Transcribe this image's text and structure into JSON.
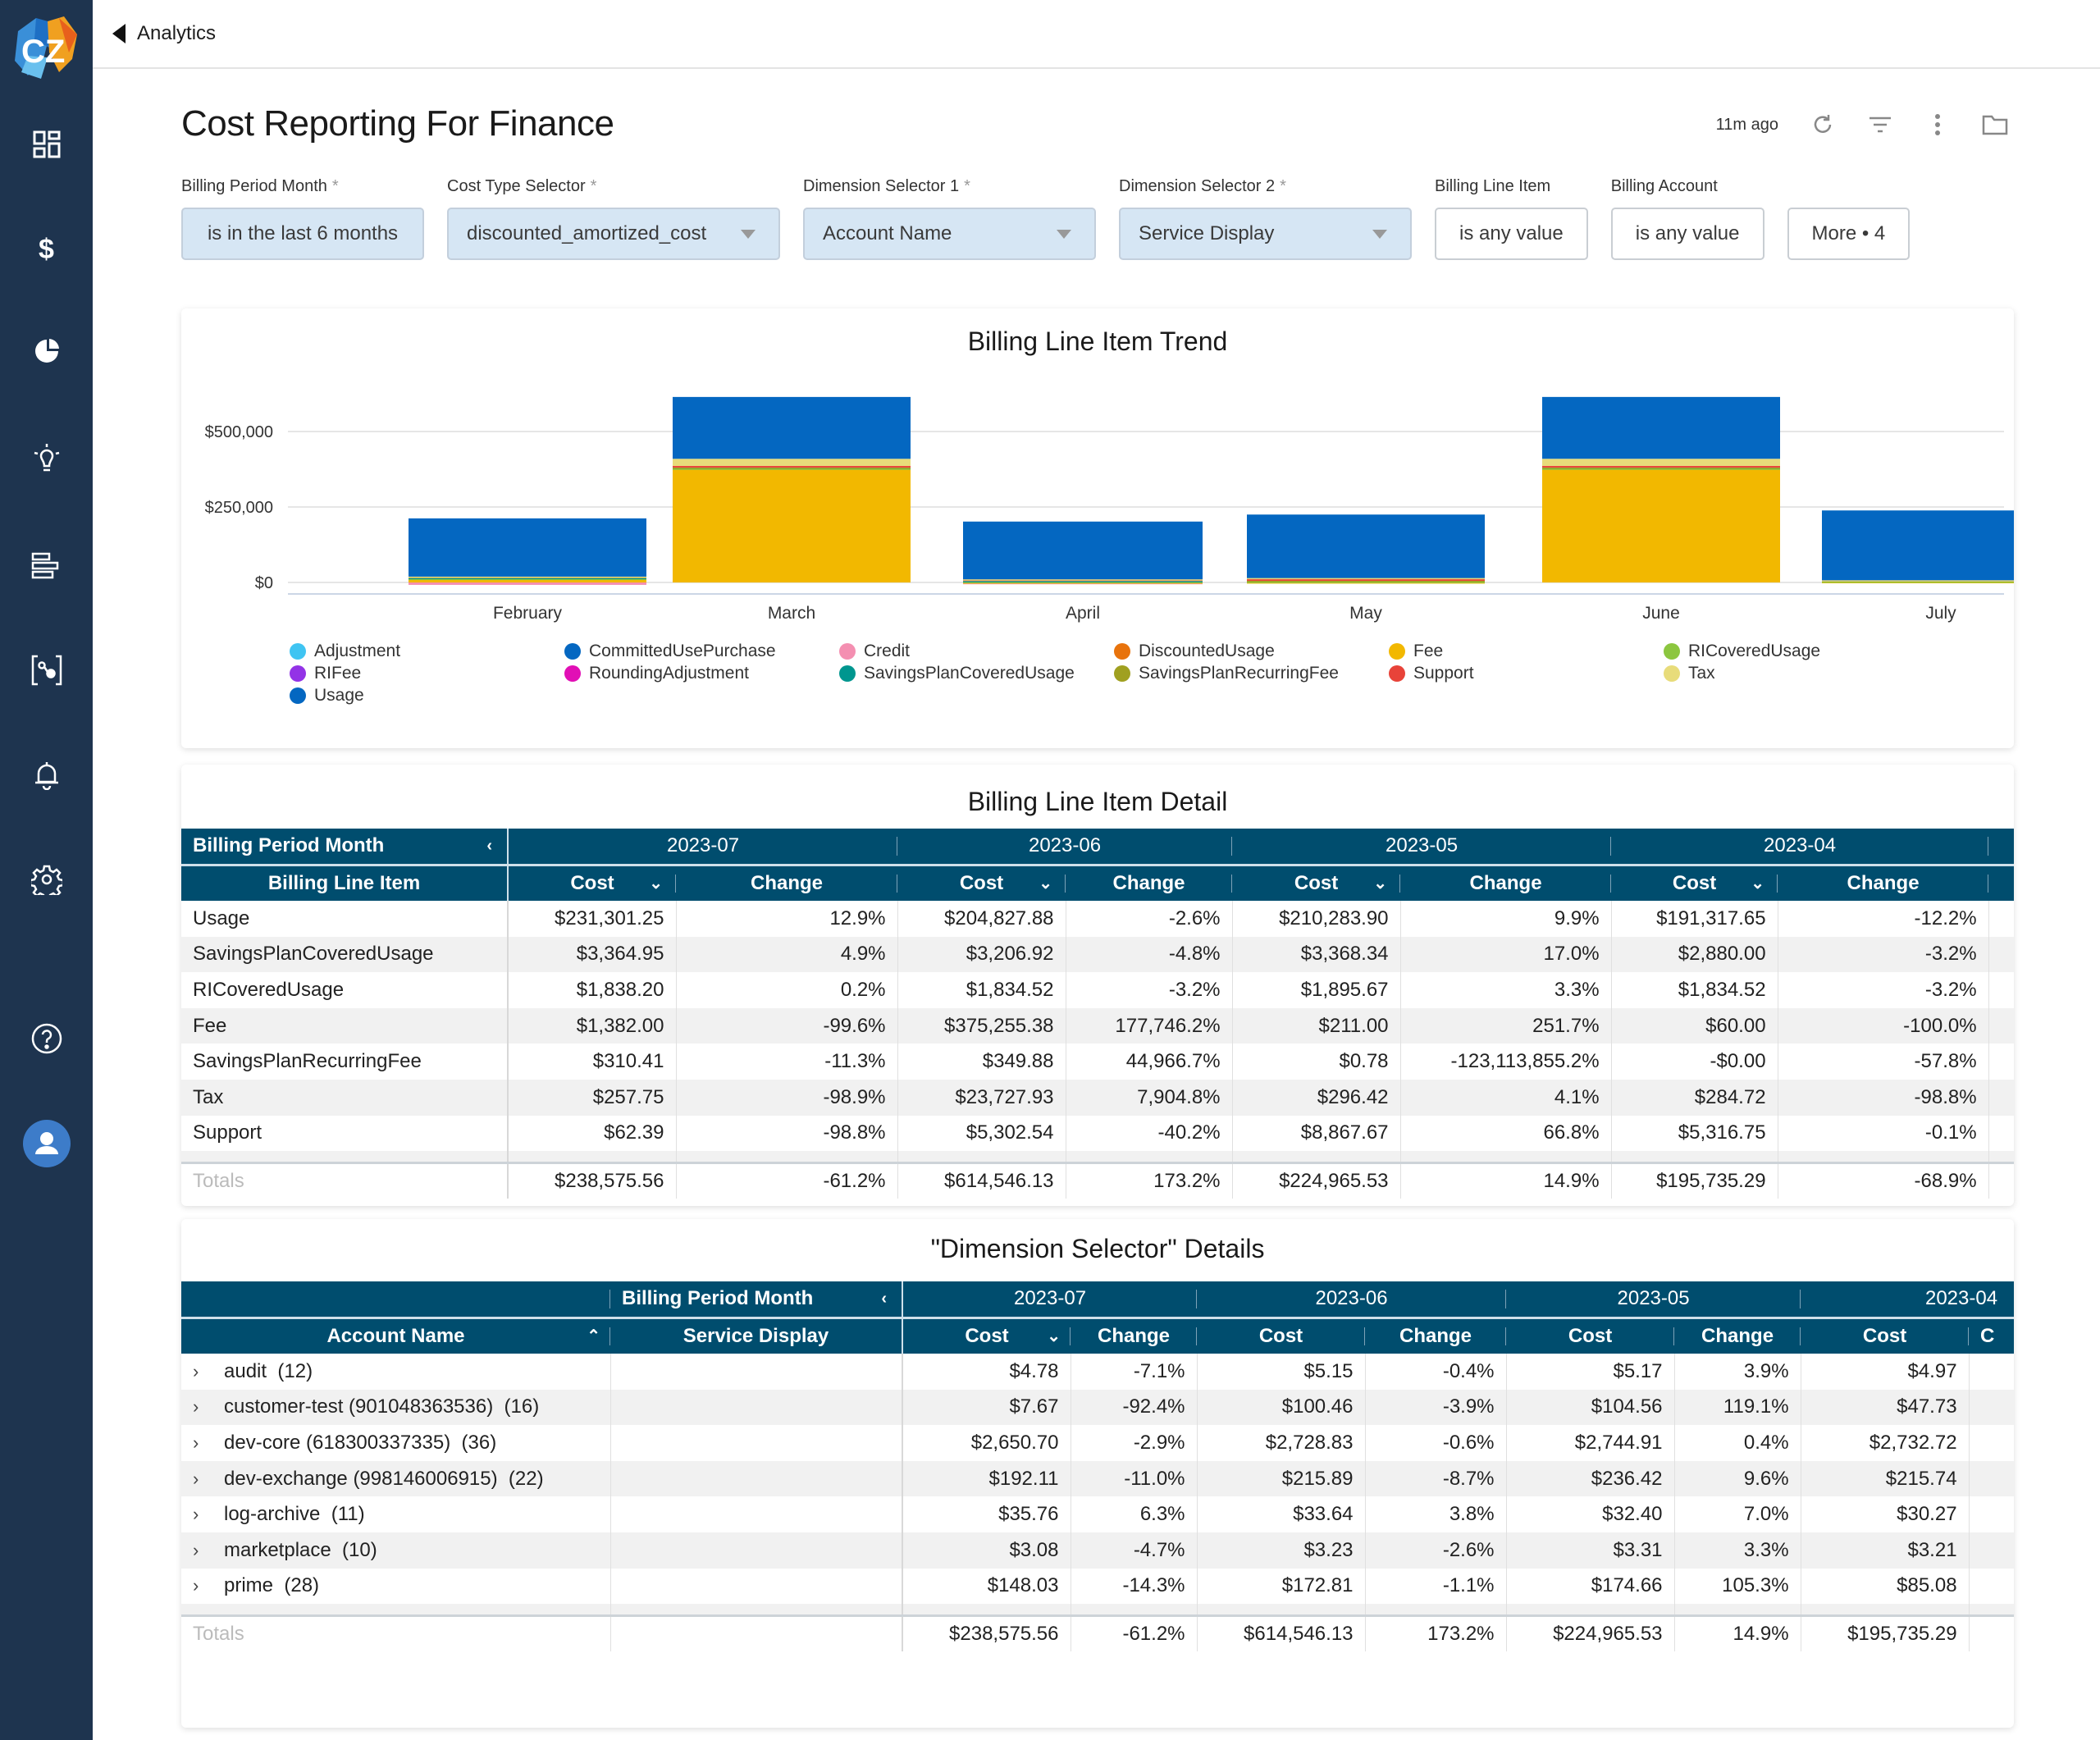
{
  "app": {
    "logo_text": "CZ",
    "breadcrumb_back": "Analytics",
    "nav_icons": [
      "dashboard-icon",
      "dollar-icon",
      "pie-chart-icon",
      "lightbulb-icon",
      "bar-list-icon",
      "anomaly-icon",
      "bell-icon",
      "gear-icon",
      "help-icon",
      "user-avatar-icon"
    ]
  },
  "page": {
    "title": "Cost Reporting For Finance",
    "updated": "11m ago"
  },
  "filters": [
    {
      "label": "Billing Period Month",
      "required": "*",
      "value": "is in the last 6 months",
      "active": true,
      "dropdown": false
    },
    {
      "label": "Cost Type Selector",
      "required": "*",
      "value": "discounted_amortized_cost",
      "active": true,
      "dropdown": true
    },
    {
      "label": "Dimension Selector 1",
      "required": "*",
      "value": "Account Name",
      "active": true,
      "dropdown": true
    },
    {
      "label": "Dimension Selector 2",
      "required": "*",
      "value": "Service Display",
      "active": true,
      "dropdown": true
    },
    {
      "label": "Billing Line Item",
      "required": "",
      "value": "is any value",
      "active": false,
      "dropdown": false
    },
    {
      "label": "Billing Account",
      "required": "",
      "value": "is any value",
      "active": false,
      "dropdown": false
    },
    {
      "label": "",
      "required": "",
      "value": "More • 4",
      "active": false,
      "dropdown": false
    }
  ],
  "chart_data": {
    "type": "bar",
    "stacked": true,
    "title": "Billing Line Item Trend",
    "xlabel": "",
    "ylabel": "",
    "categories": [
      "February",
      "March",
      "April",
      "May",
      "June",
      "July"
    ],
    "y_ticks": [
      "$0",
      "$250,000",
      "$500,000"
    ],
    "ylim": [
      0,
      620000
    ],
    "grid": true,
    "legend_position": "bottom",
    "series": [
      {
        "name": "Credit",
        "color": "#f48fb1",
        "values": [
          -8000,
          0,
          -6000,
          0,
          0,
          0
        ]
      },
      {
        "name": "Fee",
        "color": "#f2b800",
        "values": [
          10000,
          375255,
          60,
          211,
          375255,
          1382
        ]
      },
      {
        "name": "RICoveredUsage",
        "color": "#8cc63f",
        "values": [
          2000,
          1800,
          1835,
          1896,
          1835,
          1838
        ]
      },
      {
        "name": "SavingsPlanCoveredUsage",
        "color": "#00968f",
        "values": [
          3000,
          3200,
          2880,
          3368,
          3207,
          3365
        ]
      },
      {
        "name": "SavingsPlanRecurringFee",
        "color": "#a0a020",
        "values": [
          3000,
          350,
          0,
          1,
          350,
          310
        ]
      },
      {
        "name": "Support",
        "color": "#e84339",
        "values": [
          1000,
          5300,
          5317,
          8868,
          5303,
          62
        ]
      },
      {
        "name": "Tax",
        "color": "#e8dc7a",
        "values": [
          300,
          23728,
          285,
          296,
          23728,
          258
        ]
      },
      {
        "name": "Usage",
        "color": "#0467c1",
        "values": [
          193000,
          204828,
          191318,
          210284,
          204828,
          231301
        ]
      }
    ],
    "legend": [
      {
        "name": "Adjustment",
        "color": "#3fc4f2"
      },
      {
        "name": "CommittedUsePurchase",
        "color": "#0467c1"
      },
      {
        "name": "Credit",
        "color": "#f48fb1"
      },
      {
        "name": "DiscountedUsage",
        "color": "#e8730c"
      },
      {
        "name": "Fee",
        "color": "#f2b800"
      },
      {
        "name": "RICoveredUsage",
        "color": "#8cc63f"
      },
      {
        "name": "RIFee",
        "color": "#9333e6"
      },
      {
        "name": "RoundingAdjustment",
        "color": "#e10fb5"
      },
      {
        "name": "SavingsPlanCoveredUsage",
        "color": "#00968f"
      },
      {
        "name": "SavingsPlanRecurringFee",
        "color": "#a0a020"
      },
      {
        "name": "Support",
        "color": "#e84339"
      },
      {
        "name": "Tax",
        "color": "#e8dc7a"
      },
      {
        "name": "Usage",
        "color": "#0467c1"
      }
    ]
  },
  "detail_table": {
    "title": "Billing Line Item Detail",
    "pivot_label": "Billing Period Month",
    "row_header": "Billing Line Item",
    "periods": [
      "2023-07",
      "2023-06",
      "2023-05",
      "2023-04"
    ],
    "cost_label": "Cost",
    "change_label": "Change",
    "rows": [
      {
        "name": "Usage",
        "cells": [
          "$231,301.25",
          "12.9%",
          "$204,827.88",
          "-2.6%",
          "$210,283.90",
          "9.9%",
          "$191,317.65",
          "-12.2%"
        ]
      },
      {
        "name": "SavingsPlanCoveredUsage",
        "cells": [
          "$3,364.95",
          "4.9%",
          "$3,206.92",
          "-4.8%",
          "$3,368.34",
          "17.0%",
          "$2,880.00",
          "-3.2%"
        ]
      },
      {
        "name": "RICoveredUsage",
        "cells": [
          "$1,838.20",
          "0.2%",
          "$1,834.52",
          "-3.2%",
          "$1,895.67",
          "3.3%",
          "$1,834.52",
          "-3.2%"
        ]
      },
      {
        "name": "Fee",
        "cells": [
          "$1,382.00",
          "-99.6%",
          "$375,255.38",
          "177,746.2%",
          "$211.00",
          "251.7%",
          "$60.00",
          "-100.0%"
        ]
      },
      {
        "name": "SavingsPlanRecurringFee",
        "cells": [
          "$310.41",
          "-11.3%",
          "$349.88",
          "44,966.7%",
          "$0.78",
          "-123,113,855.2%",
          "-$0.00",
          "-57.8%"
        ]
      },
      {
        "name": "Tax",
        "cells": [
          "$257.75",
          "-98.9%",
          "$23,727.93",
          "7,904.8%",
          "$296.42",
          "4.1%",
          "$284.72",
          "-98.8%"
        ]
      },
      {
        "name": "Support",
        "cells": [
          "$62.39",
          "-98.8%",
          "$5,302.54",
          "-40.2%",
          "$8,867.67",
          "66.8%",
          "$5,316.75",
          "-0.1%"
        ]
      }
    ],
    "totals_label": "Totals",
    "totals": [
      "$238,575.56",
      "-61.2%",
      "$614,546.13",
      "173.2%",
      "$224,965.53",
      "14.9%",
      "$195,735.29",
      "-68.9%"
    ]
  },
  "dim_table": {
    "title": "\"Dimension Selector\" Details",
    "pivot_label": "Billing Period Month",
    "col1_header": "Account Name",
    "col2_header": "Service Display",
    "periods": [
      "2023-07",
      "2023-06",
      "2023-05",
      "2023-04"
    ],
    "cost_label": "Cost",
    "change_label": "Change",
    "truncated_header": "C",
    "rows": [
      {
        "name": "audit  (12)",
        "cells": [
          "$4.78",
          "-7.1%",
          "$5.15",
          "-0.4%",
          "$5.17",
          "3.9%",
          "$4.97"
        ]
      },
      {
        "name": "customer-test (901048363536)  (16)",
        "cells": [
          "$7.67",
          "-92.4%",
          "$100.46",
          "-3.9%",
          "$104.56",
          "119.1%",
          "$47.73"
        ]
      },
      {
        "name": "dev-core (618300337335)  (36)",
        "cells": [
          "$2,650.70",
          "-2.9%",
          "$2,728.83",
          "-0.6%",
          "$2,744.91",
          "0.4%",
          "$2,732.72"
        ]
      },
      {
        "name": "dev-exchange (998146006915)  (22)",
        "cells": [
          "$192.11",
          "-11.0%",
          "$215.89",
          "-8.7%",
          "$236.42",
          "9.6%",
          "$215.74"
        ]
      },
      {
        "name": "log-archive  (11)",
        "cells": [
          "$35.76",
          "6.3%",
          "$33.64",
          "3.8%",
          "$32.40",
          "7.0%",
          "$30.27"
        ]
      },
      {
        "name": "marketplace  (10)",
        "cells": [
          "$3.08",
          "-4.7%",
          "$3.23",
          "-2.6%",
          "$3.31",
          "3.3%",
          "$3.21"
        ]
      },
      {
        "name": "prime  (28)",
        "cells": [
          "$148.03",
          "-14.3%",
          "$172.81",
          "-1.1%",
          "$174.66",
          "105.3%",
          "$85.08"
        ]
      }
    ],
    "totals_label": "Totals",
    "totals": [
      "$238,575.56",
      "-61.2%",
      "$614,546.13",
      "173.2%",
      "$224,965.53",
      "14.9%",
      "$195,735.29"
    ]
  }
}
